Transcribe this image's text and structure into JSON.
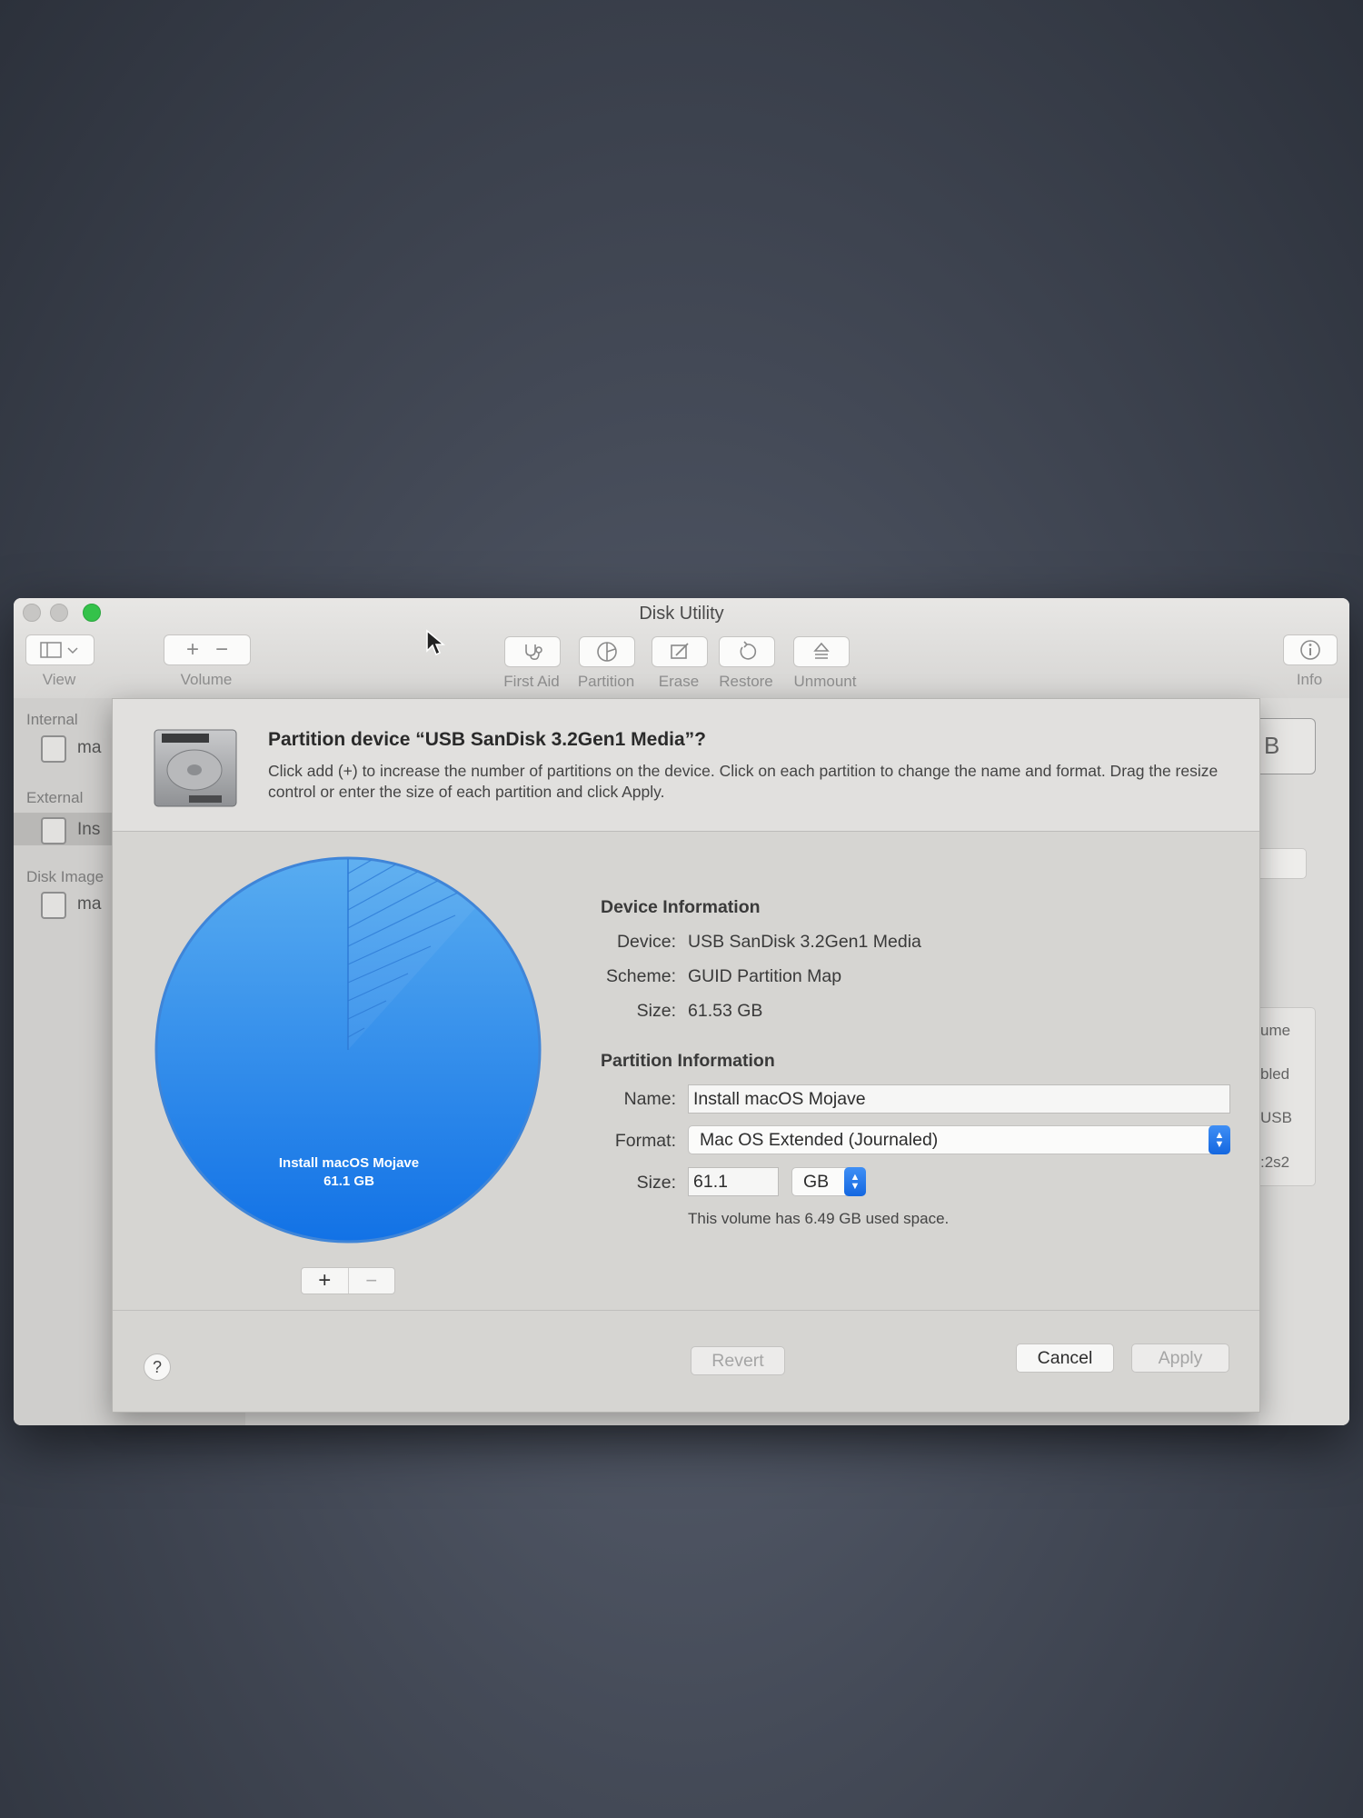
{
  "window": {
    "title": "Disk Utility",
    "toolbar": {
      "view_label": "View",
      "volume_label": "Volume",
      "first_aid_label": "First Aid",
      "partition_label": "Partition",
      "erase_label": "Erase",
      "restore_label": "Restore",
      "unmount_label": "Unmount",
      "info_label": "Info"
    }
  },
  "sidebar": {
    "internal_header": "Internal",
    "internal_item": "ma",
    "external_header": "External",
    "external_item": "Ins",
    "disk_images_header": "Disk Image",
    "disk_images_item": "ma"
  },
  "background_right": {
    "partial_box_text": "B",
    "row1": "ume",
    "row2": "bled",
    "row3": "USB",
    "row4": ":2s2"
  },
  "sheet": {
    "title": "Partition device “USB SanDisk 3.2Gen1 Media”?",
    "description": "Click add (+) to increase the number of partitions on the device. Click on each partition to change the name and format. Drag the resize control or enter the size of each partition and click Apply.",
    "pie": {
      "partition_name": "Install macOS Mojave",
      "partition_size": "61.1 GB"
    },
    "device_info": {
      "section_title": "Device Information",
      "device_label": "Device:",
      "device_value": "USB SanDisk 3.2Gen1 Media",
      "scheme_label": "Scheme:",
      "scheme_value": "GUID Partition Map",
      "size_label": "Size:",
      "size_value": "61.53 GB"
    },
    "partition_info": {
      "section_title": "Partition Information",
      "name_label": "Name:",
      "name_value": "Install macOS Mojave",
      "format_label": "Format:",
      "format_value": "Mac OS Extended (Journaled)",
      "size_label": "Size:",
      "size_value": "61.1",
      "size_unit": "GB",
      "used_note": "This volume has 6.49 GB used space."
    },
    "buttons": {
      "help": "?",
      "revert": "Revert",
      "cancel": "Cancel",
      "apply": "Apply",
      "add": "+",
      "remove": "−"
    }
  },
  "colors": {
    "pie_top": "#58acf0",
    "pie_bottom": "#1272e6",
    "accent": "#1467e0",
    "traffic_green": "#34c24a"
  }
}
